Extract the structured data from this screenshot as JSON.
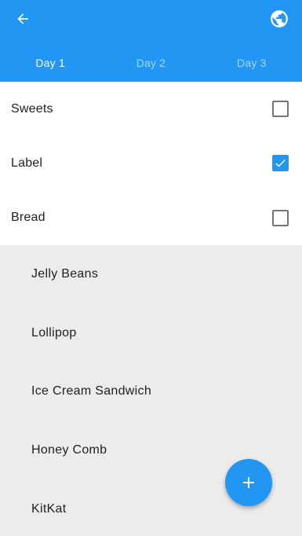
{
  "appbar": {
    "background_color": "#2196f3",
    "back_icon": "arrow-back-icon",
    "action_icon": "globe-icon"
  },
  "tabs": [
    {
      "label": "Day 1",
      "active": true
    },
    {
      "label": "Day 2",
      "active": false
    },
    {
      "label": "Day 3",
      "active": false
    }
  ],
  "checklist": [
    {
      "label": "Sweets",
      "checked": false
    },
    {
      "label": "Label",
      "checked": true
    },
    {
      "label": "Bread",
      "checked": false
    }
  ],
  "foods": [
    "Jelly Beans",
    "Lollipop",
    "Ice Cream Sandwich",
    "Honey Comb",
    "KitKat"
  ],
  "fab": {
    "icon": "plus-icon",
    "color": "#2196f3"
  }
}
